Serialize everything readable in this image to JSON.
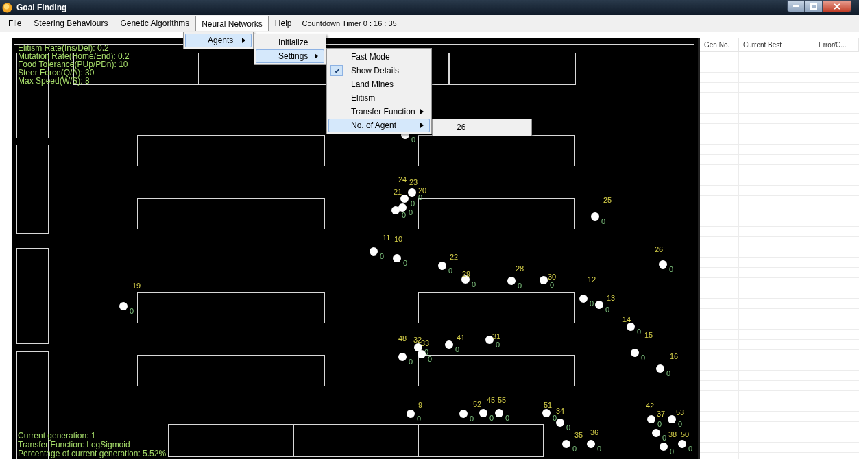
{
  "window": {
    "title": "Goal Finding"
  },
  "menu_bar": {
    "items": [
      {
        "label": "File",
        "selected": false
      },
      {
        "label": "Steering Behaviours",
        "selected": false
      },
      {
        "label": "Genetic Algorithms",
        "selected": false
      },
      {
        "label": "Neural Networks",
        "selected": true
      },
      {
        "label": "Help",
        "selected": false
      }
    ],
    "timer": "Countdown Timer 0 : 16 : 35"
  },
  "menus": [
    {
      "items": [
        {
          "label": "Agents",
          "kind": "submenu",
          "selected": true,
          "checked": false
        }
      ]
    },
    {
      "items": [
        {
          "label": "Initialize",
          "kind": "item",
          "selected": false,
          "checked": false
        },
        {
          "label": "Settings",
          "kind": "submenu",
          "selected": true,
          "checked": false
        }
      ]
    },
    {
      "items": [
        {
          "label": "Fast Mode",
          "kind": "item",
          "selected": false,
          "checked": false
        },
        {
          "label": "Show Details",
          "kind": "item",
          "selected": false,
          "checked": true
        },
        {
          "label": "Land Mines",
          "kind": "item",
          "selected": false,
          "checked": false
        },
        {
          "label": "Elitism",
          "kind": "item",
          "selected": false,
          "checked": false
        },
        {
          "label": "Transfer Function",
          "kind": "submenu",
          "selected": false,
          "checked": false
        },
        {
          "label": "No. of Agent",
          "kind": "submenu",
          "selected": true,
          "checked": false
        }
      ]
    },
    {
      "items": [
        {
          "label": "26",
          "kind": "item",
          "selected": false,
          "checked": false
        }
      ]
    }
  ],
  "canvas": {
    "stats_top": [
      "Elitism Rate(Ins/Del): 0.2",
      "Mutation Rate(Home/End): 0.2",
      "Food Tolerance(PUp/PDn): 10",
      "Steer Force(Q/A): 30",
      "Max Speed(W/S): 8"
    ],
    "stats_bottom": [
      "Current generation: 1",
      "Transfer Function: LogSigmoid",
      "Percentage of current generation: 5.52%"
    ],
    "agents": [
      {
        "score": "0"
      },
      {
        "label": "24",
        "score": "0"
      },
      {
        "label": "23",
        "score": "0"
      },
      {
        "label": "21",
        "score": "0"
      },
      {
        "label": "20",
        "score": "0"
      },
      {
        "label": "25",
        "score": "0"
      },
      {
        "label": "11",
        "score": "0"
      },
      {
        "label": "10",
        "score": "0"
      },
      {
        "label": "22",
        "score": "0"
      },
      {
        "label": "29",
        "score": "0"
      },
      {
        "label": "28",
        "score": "0"
      },
      {
        "label": "30",
        "score": "0"
      },
      {
        "label": "12",
        "score": "0"
      },
      {
        "label": "13",
        "score": "0"
      },
      {
        "label": "14",
        "score": "0"
      },
      {
        "label": "15",
        "score": "0"
      },
      {
        "label": "16",
        "score": "0"
      },
      {
        "label": "26",
        "score": "0"
      },
      {
        "label": "19",
        "score": "0"
      },
      {
        "label": "48",
        "score": "0"
      },
      {
        "label": "32",
        "score": "0"
      },
      {
        "label": "33",
        "score": "0"
      },
      {
        "label": "41",
        "score": "0"
      },
      {
        "label": "31",
        "score": "0"
      },
      {
        "label": "9",
        "score": "0"
      },
      {
        "label": "52",
        "score": "0"
      },
      {
        "label": "45",
        "score": "0"
      },
      {
        "label": "55",
        "score": "0"
      },
      {
        "label": "51",
        "score": "0"
      },
      {
        "label": "34",
        "score": "0"
      },
      {
        "label": "35",
        "score": "0"
      },
      {
        "label": "36",
        "score": "0"
      },
      {
        "label": "42",
        "score": "0"
      },
      {
        "label": "37",
        "score": "0"
      },
      {
        "label": "53",
        "score": "0"
      },
      {
        "label": "38",
        "score": "0"
      },
      {
        "label": "50",
        "score": "0"
      }
    ]
  },
  "table": {
    "columns": [
      "Gen No.",
      "Current Best",
      "Error/C..."
    ]
  }
}
